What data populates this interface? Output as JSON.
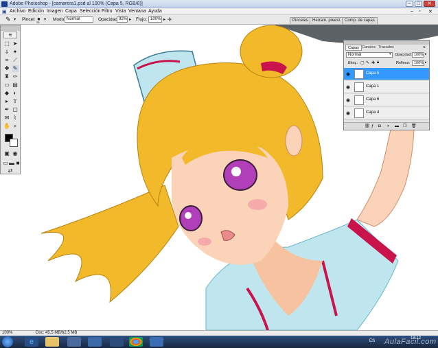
{
  "window": {
    "title": "Adobe Photoshop - [camarera1.psd al 100% (Capa 5, RGB/8)]"
  },
  "menu": [
    "Archivo",
    "Edición",
    "Imagen",
    "Capa",
    "Selección",
    "Filtro",
    "Vista",
    "Ventana",
    "Ayuda"
  ],
  "options": {
    "brush_label": "Pincel:",
    "brush_size": "25",
    "mode_label": "Modo:",
    "mode_value": "Normal",
    "opacity_label": "Opacidad:",
    "opacity_value": "92%",
    "flow_label": "Flujo:",
    "flow_value": "100%",
    "tabs": [
      "Pinceles",
      "Herram. preest.",
      "Comp. de capas"
    ]
  },
  "layers_panel": {
    "tabs": [
      "Capas",
      "Canales",
      "Trazados"
    ],
    "blend_mode": "Normal",
    "opacity_label": "Opacidad:",
    "opacity_value": "100%",
    "lock_label": "Bloq.:",
    "fill_label": "Relleno:",
    "fill_value": "100%",
    "layers": [
      {
        "name": "Capa 5",
        "selected": true
      },
      {
        "name": "Capa 1",
        "selected": false
      },
      {
        "name": "Capa 6",
        "selected": false
      },
      {
        "name": "Capa 4",
        "selected": false
      }
    ]
  },
  "status": {
    "zoom": "100%",
    "doc": "Doc: 45,5 MB/62,5 MB"
  },
  "taskbar": {
    "lang": "ES",
    "time": "18:12",
    "watermark": "AulaFacil.com"
  },
  "colors": {
    "selection": "#3399ff",
    "hair": "#f2b92a",
    "uniform": "#bfe6ef",
    "stripe": "#c8144a"
  }
}
